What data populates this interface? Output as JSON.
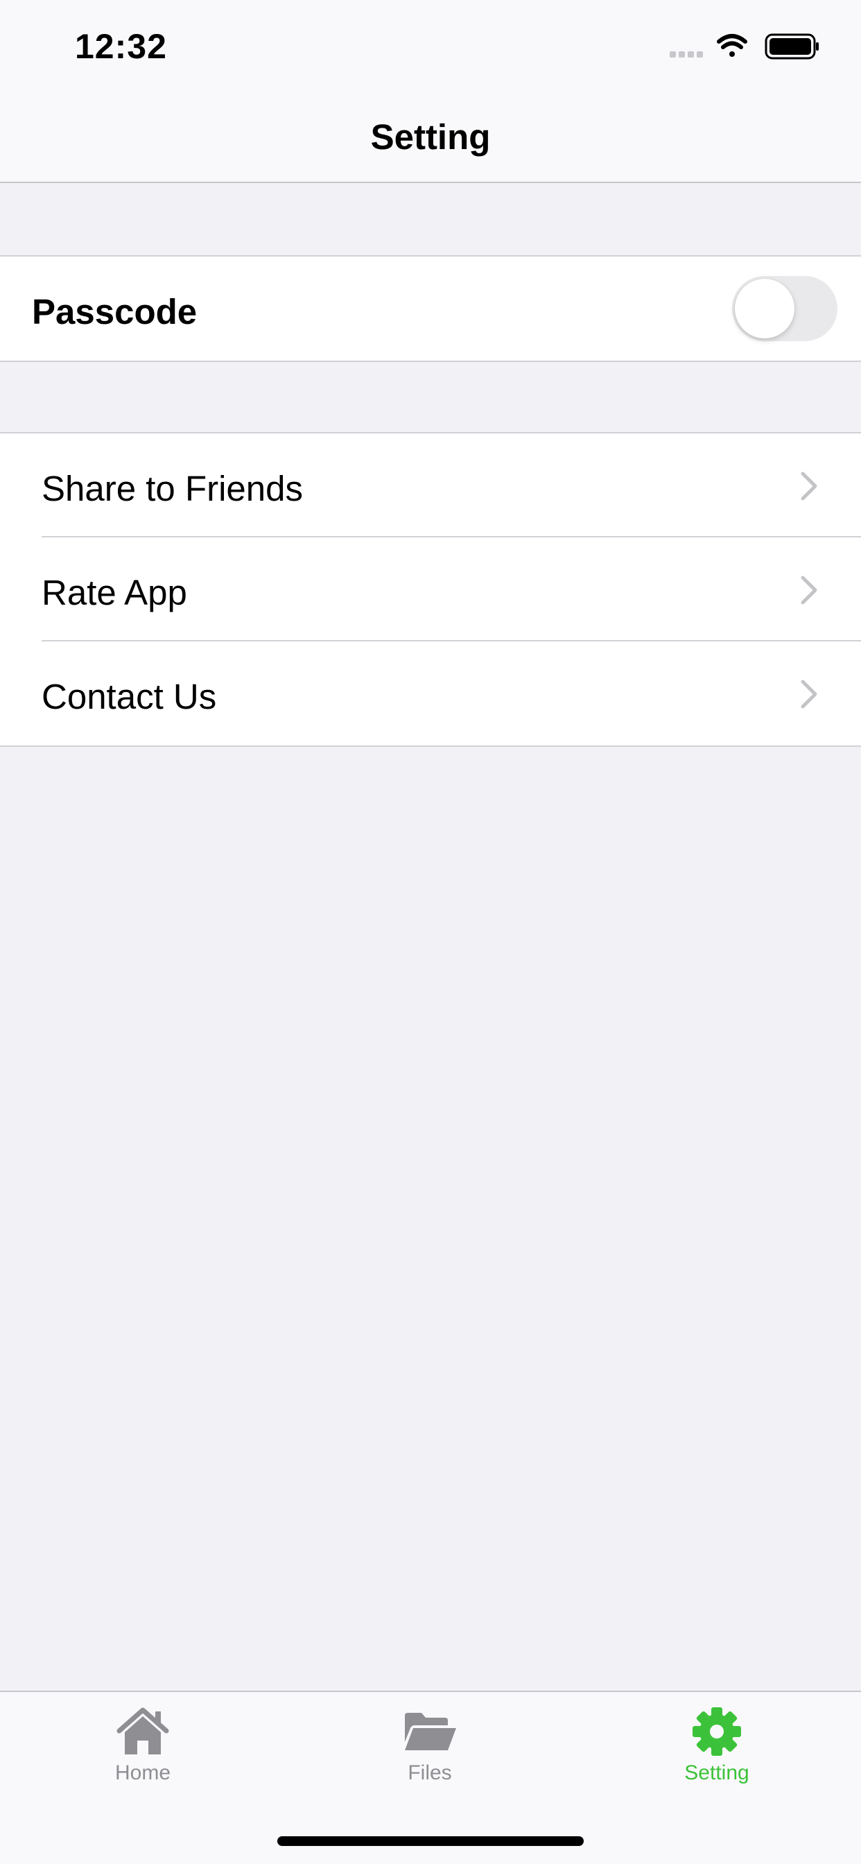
{
  "status_bar": {
    "time": "12:32",
    "icons": [
      "cellular-icon",
      "wifi-icon",
      "battery-icon"
    ]
  },
  "nav": {
    "title": "Setting"
  },
  "passcode": {
    "label": "Passcode",
    "enabled": false
  },
  "menu": {
    "items": [
      {
        "label": "Share to Friends",
        "icon": "chevron-right-icon"
      },
      {
        "label": "Rate App",
        "icon": "chevron-right-icon"
      },
      {
        "label": "Contact Us",
        "icon": "chevron-right-icon"
      }
    ]
  },
  "tabbar": {
    "tabs": [
      {
        "label": "Home",
        "icon": "home-icon",
        "active": false
      },
      {
        "label": "Files",
        "icon": "folder-icon",
        "active": false
      },
      {
        "label": "Setting",
        "icon": "gear-icon",
        "active": true
      }
    ]
  },
  "colors": {
    "accent": "#3cc23a",
    "inactive": "#8e8e93",
    "background": "#f1f1f6",
    "chevron": "#c4c4c7"
  }
}
